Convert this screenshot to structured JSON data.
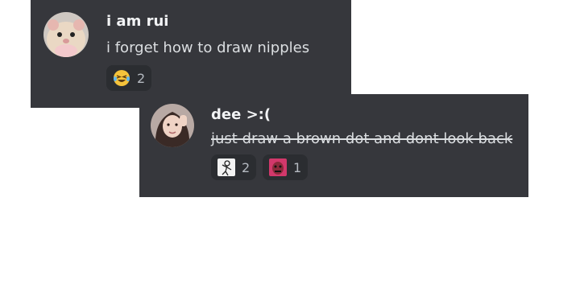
{
  "messages": [
    {
      "username": "i am rui",
      "text": "i forget how to draw nipples",
      "avatar_icon": "hamster-avatar",
      "reactions": [
        {
          "icon": "laughing-crying-emoji",
          "count": "2"
        }
      ]
    },
    {
      "username": "dee >:(",
      "text": "just draw a brown dot and dont look back",
      "text_style": "strikethrough",
      "avatar_icon": "girl-photo-avatar",
      "reactions": [
        {
          "icon": "sketch-figure-emoji",
          "count": "2"
        },
        {
          "icon": "pink-face-emoji",
          "count": "1"
        }
      ]
    }
  ],
  "colors": {
    "card_bg": "#36373c",
    "reaction_bg": "#2b2d31",
    "username": "#f2f3f5",
    "message_text": "#dbdee1",
    "reaction_count": "#b5bac1"
  }
}
